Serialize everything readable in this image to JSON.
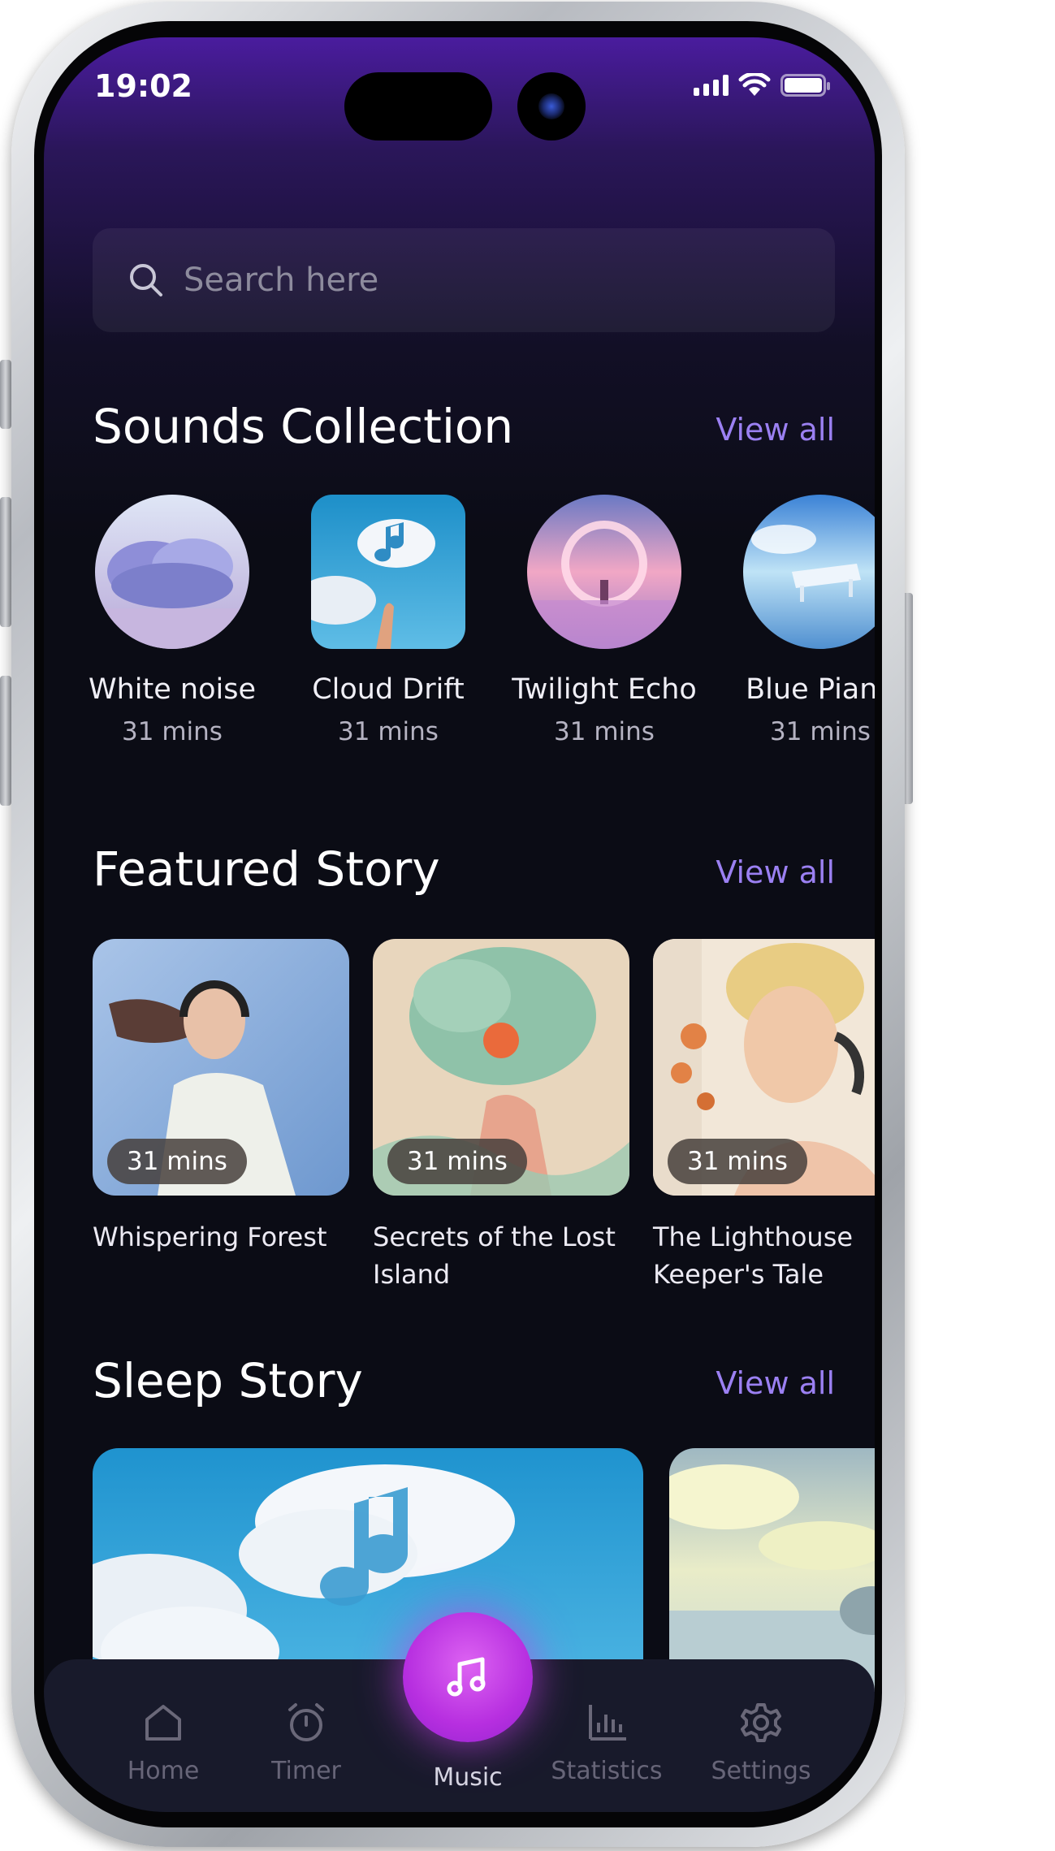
{
  "status_bar": {
    "time": "19:02"
  },
  "search": {
    "placeholder": "Search here"
  },
  "sounds": {
    "title": "Sounds Collection",
    "view_all": "View all",
    "items": [
      {
        "name": "White noise",
        "duration": "31 mins"
      },
      {
        "name": "Cloud Drift",
        "duration": "31 mins"
      },
      {
        "name": "Twilight Echo",
        "duration": "31 mins"
      },
      {
        "name": "Blue Piano",
        "duration": "31 mins"
      }
    ]
  },
  "featured": {
    "title": "Featured Story",
    "view_all": "View all",
    "items": [
      {
        "title": "Whispering Forest",
        "duration": "31 mins"
      },
      {
        "title": "Secrets of the Lost Island",
        "duration": "31 mins"
      },
      {
        "title": "The Lighthouse Keeper's Tale",
        "duration": "31 mins"
      }
    ]
  },
  "sleep": {
    "title": "Sleep Story",
    "view_all": "View all"
  },
  "tabbar": {
    "home": "Home",
    "timer": "Timer",
    "music": "Music",
    "statistics": "Statistics",
    "settings": "Settings"
  },
  "colors": {
    "accent": "#9b80f2",
    "music_button": "#c13ae6",
    "background": "#0b0c15",
    "header_gradient_top": "#4a1c9e"
  }
}
